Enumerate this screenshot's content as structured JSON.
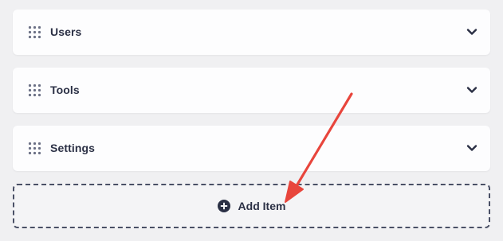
{
  "accordion": {
    "items": [
      {
        "label": "Users",
        "drag_icon": "drag-handle-icon",
        "toggle_icon": "chevron-down-icon"
      },
      {
        "label": "Tools",
        "drag_icon": "drag-handle-icon",
        "toggle_icon": "chevron-down-icon"
      },
      {
        "label": "Settings",
        "drag_icon": "drag-handle-icon",
        "toggle_icon": "chevron-down-icon"
      }
    ]
  },
  "add_item": {
    "label": "Add Item",
    "icon": "plus-circle-icon"
  },
  "annotation": {
    "icon": "arrow-icon",
    "color": "#e8453c"
  },
  "colors": {
    "background": "#f0f0f2",
    "card": "#fdfdfe",
    "text": "#2b3045",
    "dashed_border": "#4a5066"
  }
}
